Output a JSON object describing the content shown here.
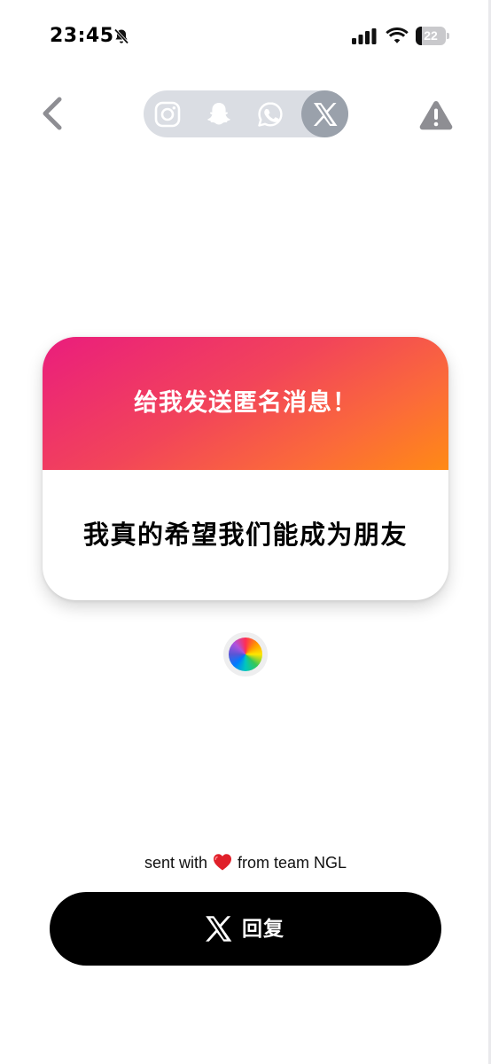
{
  "status_bar": {
    "time": "23:45",
    "battery_percent": "22",
    "battery_level": 0.22,
    "icons": [
      "bell-slash-icon",
      "signal-icon",
      "wifi-icon",
      "battery-icon"
    ]
  },
  "nav": {
    "back_icon": "chevron-left-icon",
    "share_targets": [
      {
        "icon": "instagram-icon",
        "active": false
      },
      {
        "icon": "snapchat-icon",
        "active": false
      },
      {
        "icon": "whatsapp-icon",
        "active": false
      },
      {
        "icon": "x-icon",
        "active": true
      }
    ],
    "report_icon": "warning-icon"
  },
  "card": {
    "header_text": "给我发送匿名消息！",
    "message": "我真的希望我们能成为朋友",
    "gradient_colors": [
      "#ea1d7d",
      "#f2445a",
      "#fb6a3a",
      "#ff8a15"
    ]
  },
  "color_picker": {
    "icon": "color-wheel-icon"
  },
  "footer": {
    "sent_prefix": "sent with",
    "sent_suffix": "from team NGL",
    "heart_icon": "heart-icon",
    "reply_label": "回复",
    "reply_icon": "x-icon"
  },
  "colors": {
    "pill_bg": "#dadde3",
    "active_pill": "#9aa1ab",
    "icon_gray": "#8e8e93",
    "button_bg": "#000000",
    "heart": "#e0202a"
  }
}
